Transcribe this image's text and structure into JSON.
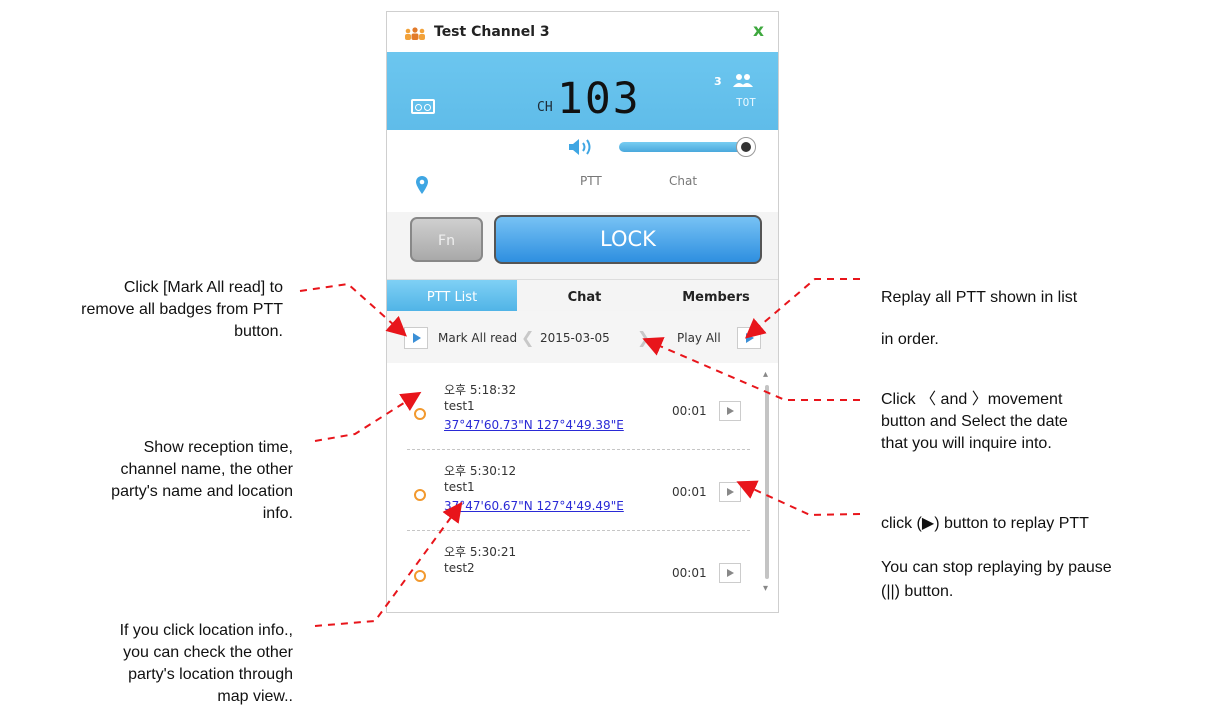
{
  "window": {
    "title": "Test Channel 3",
    "close_label": "x"
  },
  "display": {
    "channel_prefix": "CH",
    "channel_number": "103",
    "member_count": "3",
    "tot_label": "TOT"
  },
  "controls": {
    "ptt_label": "PTT",
    "chat_label": "Chat",
    "volume_level": 1.0
  },
  "buttons": {
    "fn_label": "Fn",
    "lock_label": "LOCK"
  },
  "tabs": [
    {
      "label": "PTT List",
      "active": true
    },
    {
      "label": "Chat",
      "active": false
    },
    {
      "label": "Members",
      "active": false
    }
  ],
  "toolbar": {
    "mark_all_label": "Mark All read",
    "date": "2015-03-05",
    "play_all_label": "Play All"
  },
  "ptt_list": [
    {
      "time": "오후 5:18:32",
      "name": "test1",
      "location": "37°47'60.73\"N 127°4'49.38\"E",
      "duration": "00:01"
    },
    {
      "time": "오후 5:30:12",
      "name": "test1",
      "location": "37°47'60.67\"N 127°4'49.49\"E",
      "duration": "00:01"
    },
    {
      "time": "오후 5:30:21",
      "name": "test2",
      "location": "",
      "duration": "00:01"
    }
  ],
  "annotations": {
    "mark_all": [
      "Click [Mark All read] to",
      "remove all badges from PTT",
      "button."
    ],
    "reception": [
      "Show reception time,",
      "channel name, the other",
      "party's name and location",
      "info."
    ],
    "location": [
      "If you click location info.,",
      "you can check the other",
      "party's location through",
      "map view.."
    ],
    "play_all": [
      "Replay all PTT shown in list",
      "in order."
    ],
    "date_nav": [
      "Click 〈  and  〉movement",
      "button and Select the date",
      "that you will inquire into."
    ],
    "replay": "click (▶) button to replay PTT",
    "pause": [
      "You can stop replaying by pause",
      "(||) button."
    ]
  },
  "colors": {
    "display_bg": "#62bfea",
    "accent_blue": "#3b8fd6",
    "status_orange": "#f2992e",
    "close_green": "#3ea83e",
    "arrow_red": "#e8151b"
  }
}
